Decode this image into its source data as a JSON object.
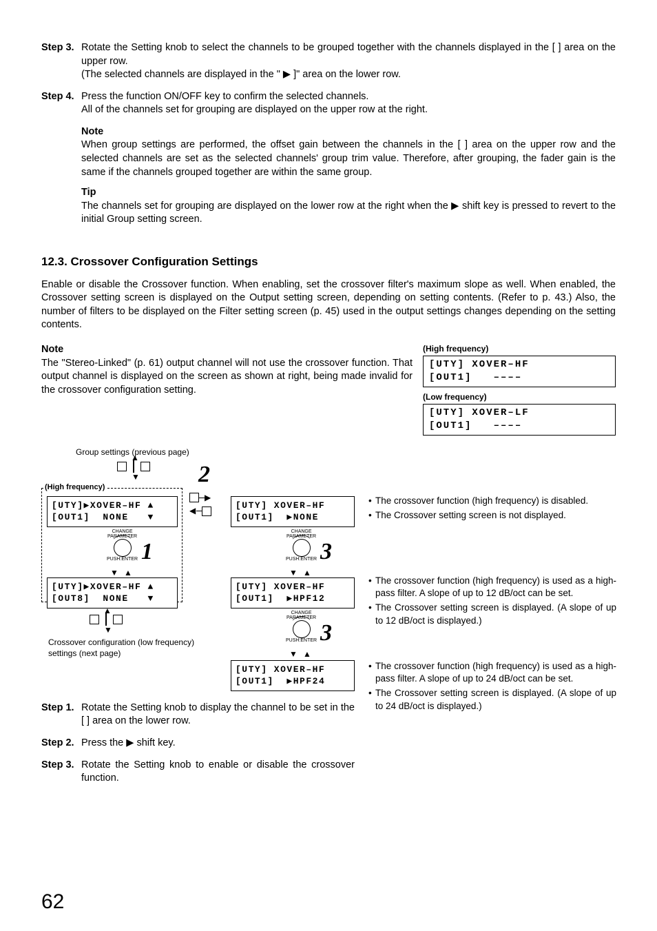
{
  "steps_top": [
    {
      "label": "Step 3.",
      "body": "Rotate the Setting knob to select the channels to be grouped together with the channels displayed in the [   ] area on the upper row.",
      "extra": "(The selected channels are displayed in the \"   \" area on the lower row."
    },
    {
      "label": "Step 4.",
      "body": "Press the function ON/OFF key to confirm the selected channels.",
      "extra": "All of the channels set for grouping are displayed on the upper row at the right."
    }
  ],
  "note_hdr": "Note",
  "note_body": "When group settings are performed, the offset gain between the channels in the [    ] area on the upper row and the selected channels are set as the selected channels' group trim value. Therefore, after grouping, the fader gain is the same if the channels grouped together are within the same group.",
  "tip_hdr": "Tip",
  "tip_body_a": "The channels set for grouping are displayed on the lower row at the right when the ",
  "tip_body_b": " shift key is pressed to revert to the initial Group setting screen.",
  "section": "12.3. Crossover Configuration Settings",
  "intro": "Enable or disable the Crossover function. When enabling, set the crossover filter's maximum slope as well. When enabled, the Crossover setting screen is displayed on the Output setting screen, depending on setting contents. (Refer to p. 43.) Also, the number of filters to be displayed on the Filter setting screen (p. 45) used in the output settings changes depending on the setting contents.",
  "note2_hdr": "Note",
  "note2_body": "The \"Stereo-Linked\" (p. 61) output channel will not use the crossover function. That output channel is displayed on the screen as shown at right, being made invalid for the crossover configuration setting.",
  "hi_lbl": "(High frequency)",
  "lo_lbl": "(Low frequency)",
  "lcd_hi1": "[UTY] XOVER–HF",
  "lcd_hi2": "[OUT1]   ––––",
  "lcd_lo1": "[UTY] XOVER–LF",
  "lcd_lo2": "[OUT1]   ––––",
  "diag": {
    "group_prev": "Group settings (previous page)",
    "hf": "(High frequency)",
    "lcd_a1": "[UTY]▶XOVER–HF ▲",
    "lcd_a2": "[OUT1]  NONE   ▼",
    "lcd_b1": "[UTY]▶XOVER–HF ▲",
    "lcd_b2": "[OUT8]  NONE   ▼",
    "lcd_c1": "[UTY] XOVER–HF",
    "lcd_c2": "[OUT1]  ▶NONE",
    "lcd_d1": "[UTY] XOVER–HF",
    "lcd_d2": "[OUT1]  ▶HPF12",
    "lcd_e1": "[UTY] XOVER–HF",
    "lcd_e2": "[OUT1]  ▶HPF24",
    "next": "Crossover configuration (low frequency) settings (next page)",
    "change": "CHANGE\nPARAMETER",
    "push": "PUSH:ENTER",
    "n1": "1",
    "n2": "2",
    "n3": "3",
    "b1a": "The crossover function (high frequency) is disabled.",
    "b1b": "The Crossover setting screen is not displayed.",
    "b2a": "The crossover function (high frequency) is used as a high-pass filter. A slope of up to 12 dB/oct can be set.",
    "b2b": "The Crossover setting screen is displayed. (A slope of up to 12 dB/oct is displayed.)",
    "b3a": "The crossover function (high frequency) is used as a high-pass filter. A slope of up to 24 dB/oct can be set.",
    "b3b": "The Crossover setting screen is displayed. (A slope of up to 24 dB/oct is displayed.)"
  },
  "steps_bot": [
    {
      "label": "Step 1.",
      "body": "Rotate the Setting knob to display the channel to be set in the [   ] area on the lower row."
    },
    {
      "label": "Step 2.",
      "body_a": "Press the ",
      "body_b": " shift key."
    },
    {
      "label": "Step 3.",
      "body": "Rotate the Setting knob to enable or disable the crossover function."
    }
  ],
  "page": "62"
}
